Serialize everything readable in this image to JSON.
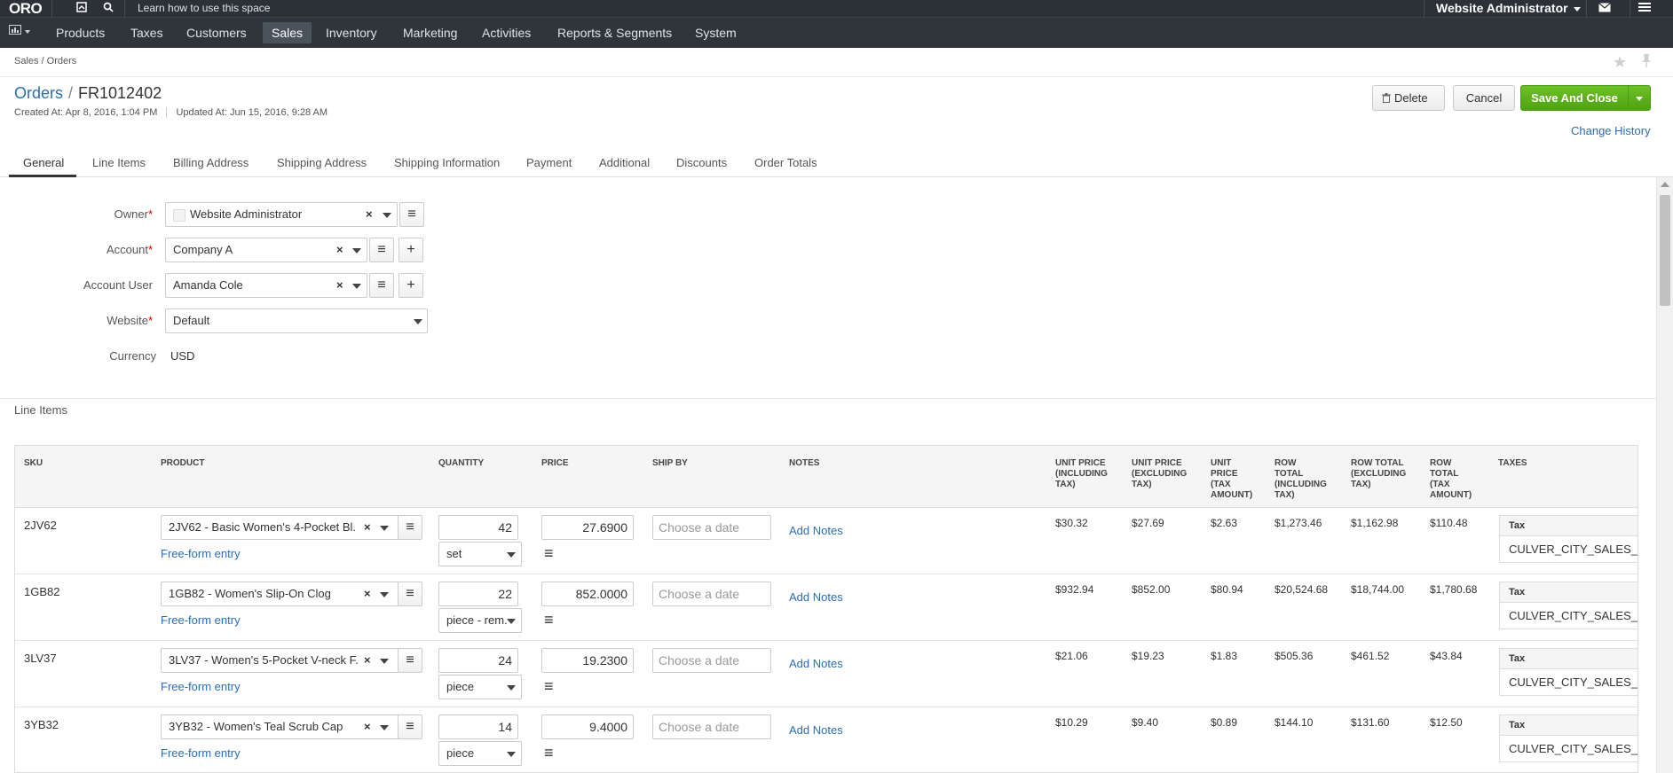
{
  "topbar": {
    "logo": "ORO",
    "learn_text": "Learn how to use this space",
    "user": "Website Administrator"
  },
  "nav": {
    "items": [
      "Products",
      "Taxes",
      "Customers",
      "Sales",
      "Inventory",
      "Marketing",
      "Activities",
      "Reports & Segments",
      "System"
    ],
    "active": "Sales"
  },
  "breadcrumb": "Sales / Orders",
  "title": {
    "crumb": "Orders",
    "record": "FR1012402"
  },
  "meta": {
    "created": "Created At: Apr 8, 2016, 1:04 PM",
    "updated": "Updated At: Jun 15, 2016, 9:28 AM"
  },
  "actions": {
    "delete": "Delete",
    "cancel": "Cancel",
    "save": "Save And Close",
    "change_history": "Change History"
  },
  "tabs": [
    "General",
    "Line Items",
    "Billing Address",
    "Shipping Address",
    "Shipping Information",
    "Payment",
    "Additional",
    "Discounts",
    "Order Totals"
  ],
  "form": {
    "owner": {
      "label": "Owner",
      "value": "Website Administrator"
    },
    "account": {
      "label": "Account",
      "value": "Company A"
    },
    "account_user": {
      "label": "Account User",
      "value": "Amanda Cole"
    },
    "website": {
      "label": "Website",
      "value": "Default"
    },
    "currency": {
      "label": "Currency",
      "value": "USD"
    }
  },
  "line_items": {
    "section_title": "Line Items",
    "headers": {
      "sku": "SKU",
      "product": "PRODUCT",
      "quantity": "QUANTITY",
      "price": "PRICE",
      "ship_by": "SHIP BY",
      "notes": "NOTES",
      "unit_incl": [
        "UNIT PRICE",
        "(INCLUDING",
        "TAX)"
      ],
      "unit_excl": [
        "UNIT PRICE",
        "(EXCLUDING",
        "TAX)"
      ],
      "unit_tax": [
        "UNIT",
        "PRICE",
        "(TAX",
        "AMOUNT)"
      ],
      "row_incl": [
        "ROW",
        "TOTAL",
        "(INCLUDING",
        "TAX)"
      ],
      "row_excl": [
        "ROW TOTAL",
        "(EXCLUDING",
        "TAX)"
      ],
      "row_tax": [
        "ROW",
        "TOTAL",
        "(TAX",
        "AMOUNT)"
      ],
      "taxes": "TAXES"
    },
    "free_form": "Free-form entry",
    "date_placeholder": "Choose a date",
    "add_notes": "Add Notes",
    "tax_label": "Tax",
    "rows": [
      {
        "sku": "2JV62",
        "product": "2JV62 - Basic Women's 4-Pocket Bl.",
        "qty": "42",
        "unit": "set",
        "price": "27.6900",
        "unit_incl": "$30.32",
        "unit_excl": "$27.69",
        "unit_tax": "$2.63",
        "row_incl": "$1,273.46",
        "row_excl": "$1,162.98",
        "row_tax": "$110.48",
        "tax_code": "CULVER_CITY_SALES_"
      },
      {
        "sku": "1GB82",
        "product": "1GB82 - Women's Slip-On Clog",
        "qty": "22",
        "unit": "piece - rem.",
        "price": "852.0000",
        "unit_incl": "$932.94",
        "unit_excl": "$852.00",
        "unit_tax": "$80.94",
        "row_incl": "$20,524.68",
        "row_excl": "$18,744.00",
        "row_tax": "$1,780.68",
        "tax_code": "CULVER_CITY_SALES_"
      },
      {
        "sku": "3LV37",
        "product": "3LV37 - Women's 5-Pocket V-neck F.",
        "qty": "24",
        "unit": "piece",
        "price": "19.2300",
        "unit_incl": "$21.06",
        "unit_excl": "$19.23",
        "unit_tax": "$1.83",
        "row_incl": "$505.36",
        "row_excl": "$461.52",
        "row_tax": "$43.84",
        "tax_code": "CULVER_CITY_SALES_"
      },
      {
        "sku": "3YB32",
        "product": "3YB32 - Women's Teal Scrub Cap",
        "qty": "14",
        "unit": "piece",
        "price": "9.4000",
        "unit_incl": "$10.29",
        "unit_excl": "$9.40",
        "unit_tax": "$0.89",
        "row_incl": "$144.10",
        "row_excl": "$131.60",
        "row_tax": "$12.50",
        "tax_code": "CULVER_CITY_SALES_"
      }
    ]
  },
  "colors": {
    "link": "#2a6eb4",
    "primary": "#5aad1b",
    "topbar": "#2b3137",
    "nav": "#2f353b"
  }
}
